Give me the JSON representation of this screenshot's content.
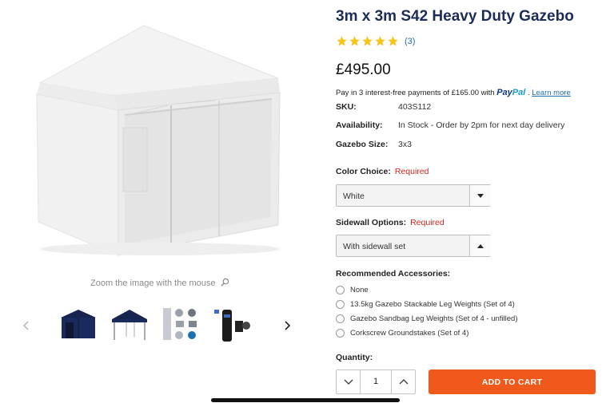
{
  "product": {
    "title": "3m x 3m S42 Heavy Duty Gazebo",
    "rating_value": 5,
    "rating_count": "(3)",
    "price": "£495.00",
    "paypal": {
      "prefix": "Pay in 3 interest-free payments of £165.00 with",
      "logo_pay": "Pay",
      "logo_pal": "Pal",
      "learn_more": "Learn more"
    },
    "meta": [
      {
        "key": "SKU:",
        "value": "403S112"
      },
      {
        "key": "Availability:",
        "value": "In Stock - Order by 2pm for next day delivery"
      },
      {
        "key": "Gazebo Size:",
        "value": "3x3"
      }
    ]
  },
  "options": {
    "color": {
      "label": "Color Choice:",
      "required": "Required",
      "selected": "White"
    },
    "sidewall": {
      "label": "Sidewall Options:",
      "required": "Required",
      "selected": "With sidewall set"
    }
  },
  "accessories": {
    "title": "Recommended Accessories:",
    "items": [
      "None",
      "13.5kg Gazebo Stackable Leg Weights (Set of 4)",
      "Gazebo Sandbag Leg Weights (Set of 4 - unfilled)",
      "Corkscrew Groundstakes (Set of 4)"
    ]
  },
  "quantity": {
    "label": "Quantity:",
    "value": "1"
  },
  "cart": {
    "label": "ADD TO CART"
  },
  "gallery": {
    "zoom_hint": "Zoom the image with the mouse",
    "thumbnails": [
      "gazebo-navy-sidewalls",
      "gazebo-navy-open",
      "accessories-parts",
      "gazebo-packed-bag"
    ],
    "icons": {
      "zoom": "magnifier-icon",
      "prev": "chevron-left-icon",
      "next": "chevron-right-icon"
    }
  },
  "colors": {
    "title": "#1b2d57",
    "star": "#f5c518",
    "link": "#1f6fb2",
    "required": "#d0271f",
    "cart_button": "#f0581c",
    "navy_thumb": "#16244f"
  }
}
